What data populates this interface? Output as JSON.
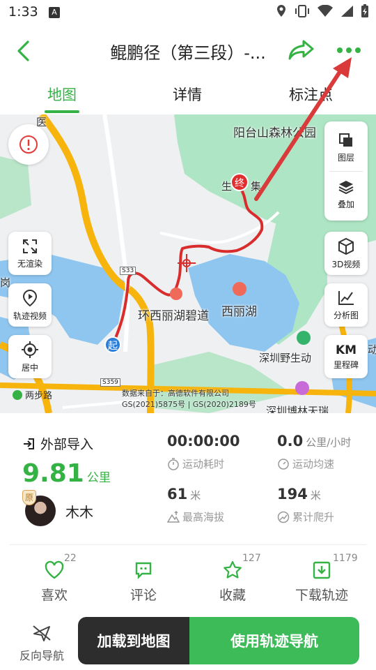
{
  "status_bar": {
    "time": "1:33",
    "notif_icon": "A"
  },
  "header": {
    "title": "鲲鹏径（第三段）-...",
    "back_icon": "chevron-left-icon",
    "share_icon": "share-icon",
    "more_icon": "more-dots-icon",
    "accent": "#35b244"
  },
  "tabs": [
    {
      "label": "地图"
    },
    {
      "label": "详情"
    },
    {
      "label": "标注点"
    }
  ],
  "map": {
    "labels": {
      "park": "阳台山森林公园",
      "lake_road": "环西丽湖碧道",
      "lake": "西丽湖",
      "zoo": "深圳野生动",
      "museum": "深圳博林天瑞",
      "road": "两步路",
      "end_fragment_left": "生",
      "end_fragment_right": "集",
      "road_sign": "S359",
      "road_sign2": "S33",
      "left_fragment": "岗",
      "right_edge": "动",
      "top_left": "医"
    },
    "start_marker": "起",
    "end_marker": "终",
    "copyright_line1": "数据来自于：高德软件有限公司",
    "copyright_line2": "GS(2021)5875号 | GS(2020)2189号",
    "left_buttons": [
      {
        "label": "无渲染"
      },
      {
        "label": "轨迹视频"
      },
      {
        "label": "居中"
      }
    ],
    "right_buttons": [
      {
        "label": "图层"
      },
      {
        "label": "叠加"
      },
      {
        "label": "3D视频"
      },
      {
        "label": "分析图"
      },
      {
        "label": "里程碑",
        "title": "KM"
      }
    ]
  },
  "stats": {
    "source": "外部导入",
    "distance": "9.81",
    "distance_unit": "公里",
    "user_badge": "原",
    "user_name": "木木",
    "duration": "00:00:00",
    "duration_label": "运动耗时",
    "speed": "0.0",
    "speed_unit": "公里/小时",
    "speed_label": "运动均速",
    "max_alt": "61",
    "max_alt_unit": "米",
    "max_alt_label": "最高海拔",
    "climb": "194",
    "climb_unit": "米",
    "climb_label": "累计爬升"
  },
  "actions": [
    {
      "label": "喜欢",
      "count": "22"
    },
    {
      "label": "评论",
      "count": ""
    },
    {
      "label": "收藏",
      "count": "127"
    },
    {
      "label": "下载轨迹",
      "count": "1179"
    }
  ],
  "bottom": {
    "reverse_label": "反向导航",
    "load_label": "加载到地图",
    "nav_label": "使用轨迹导航"
  }
}
